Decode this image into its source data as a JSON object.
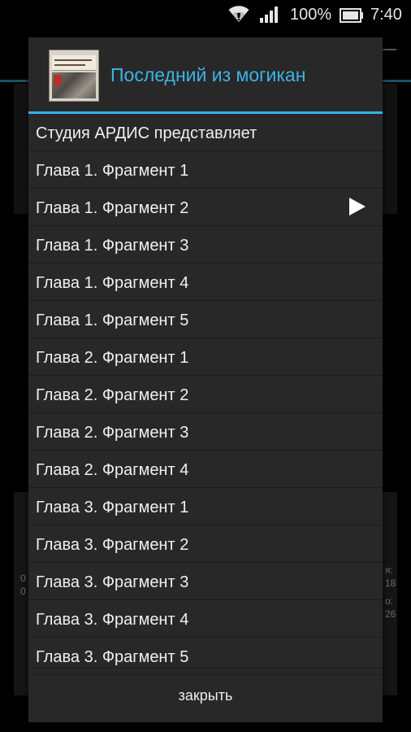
{
  "status_bar": {
    "battery": "100%",
    "time": "7:40"
  },
  "background": {
    "left_text": [
      "0",
      "0"
    ],
    "right_text": [
      "я:",
      "18",
      "о:",
      "26"
    ]
  },
  "dialog": {
    "title": "Последний из могикан",
    "items": [
      {
        "label": "Студия АРДИС представляет",
        "playing": false
      },
      {
        "label": "Глава 1. Фрагмент 1",
        "playing": false
      },
      {
        "label": "Глава 1. Фрагмент 2",
        "playing": true
      },
      {
        "label": "Глава 1. Фрагмент 3",
        "playing": false
      },
      {
        "label": "Глава 1. Фрагмент 4",
        "playing": false
      },
      {
        "label": "Глава 1. Фрагмент 5",
        "playing": false
      },
      {
        "label": "Глава 2. Фрагмент 1",
        "playing": false
      },
      {
        "label": "Глава 2. Фрагмент 2",
        "playing": false
      },
      {
        "label": "Глава 2. Фрагмент 3",
        "playing": false
      },
      {
        "label": "Глава 2. Фрагмент 4",
        "playing": false
      },
      {
        "label": "Глава 3. Фрагмент 1",
        "playing": false
      },
      {
        "label": "Глава 3. Фрагмент 2",
        "playing": false
      },
      {
        "label": "Глава 3. Фрагмент 3",
        "playing": false
      },
      {
        "label": "Глава 3. Фрагмент 4",
        "playing": false
      },
      {
        "label": "Глава 3. Фрагмент 5",
        "playing": false
      }
    ],
    "close_label": "закрыть"
  },
  "colors": {
    "accent": "#33b5e5",
    "title": "#3cb4e6",
    "dialog_bg": "#282828"
  },
  "icons": {
    "status": [
      "wifi-icon",
      "signal-icon",
      "battery-icon"
    ],
    "header": "book-cover-image",
    "now_playing": "play-icon"
  }
}
